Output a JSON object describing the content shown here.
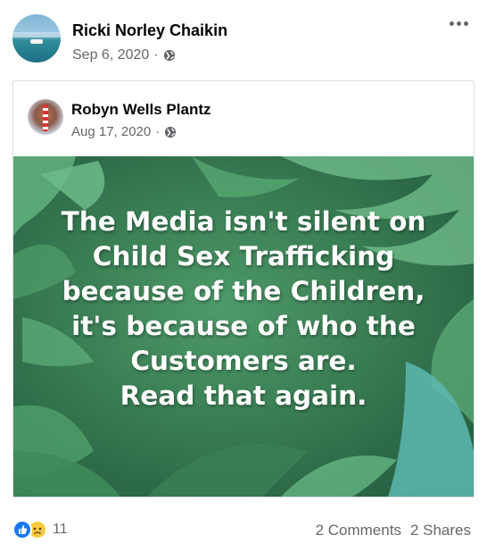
{
  "post": {
    "author": "Ricki Norley Chaikin",
    "date": "Sep 6, 2020",
    "meta_separator": "·",
    "privacy_icon": "globe-icon",
    "more_icon": "more-options-icon"
  },
  "shared_post": {
    "author": "Robyn Wells Plantz",
    "date": "Aug 17, 2020",
    "meta_separator": "·",
    "privacy_icon": "globe-icon",
    "image_text": {
      "line1": "The Media isn't silent on",
      "line2": "Child Sex Trafficking",
      "line3": "because of the Children,",
      "line4": "it's because of who the",
      "line5": "Customers are.",
      "line6": "Read that again."
    }
  },
  "footer": {
    "reaction_icons": [
      "like-icon",
      "sad-icon"
    ],
    "reaction_count": "11",
    "comments": "2 Comments",
    "shares": "2 Shares"
  },
  "colors": {
    "link_blue": "#1877f2",
    "secondary_text": "#65676b",
    "image_green": "#3b8055"
  }
}
